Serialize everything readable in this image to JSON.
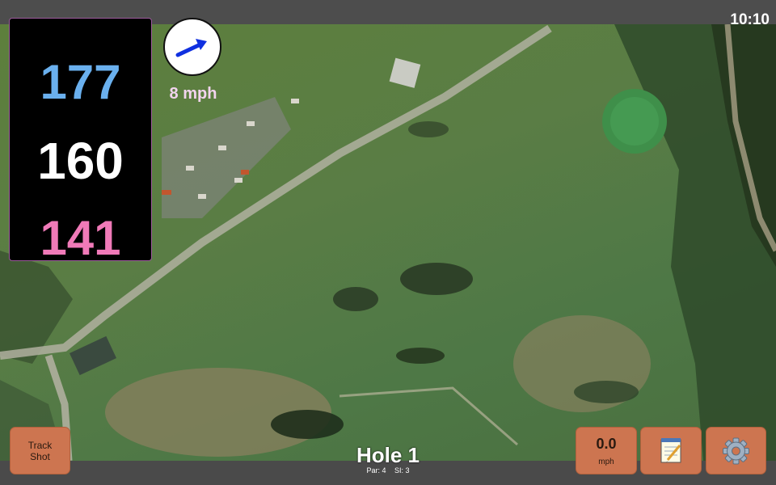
{
  "status": {
    "time": "10:10"
  },
  "distances": {
    "back": "177",
    "middle": "160",
    "front": "141"
  },
  "wind": {
    "speed": "8 mph",
    "icon": "wind-arrow-icon"
  },
  "buttons": {
    "track_line1": "Track",
    "track_line2": "Shot",
    "speed_value": "0.0",
    "speed_unit": "mph",
    "notes_icon": "notepad-icon",
    "settings_icon": "gear-icon"
  },
  "hole": {
    "title": "Hole 1",
    "par": "Par: 4",
    "si": "SI: 3"
  },
  "colors": {
    "back": "#6ab0ee",
    "middle": "#ffffff",
    "front": "#f07ab8",
    "button": "#cd7550"
  }
}
